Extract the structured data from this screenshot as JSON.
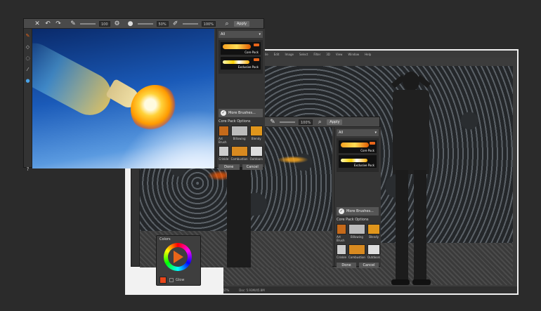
{
  "front_window": {
    "toolbar": {
      "field_1": "100",
      "field_2": "50%",
      "field_3": "100%",
      "apply_label": "Apply"
    },
    "panel": {
      "dropdown_value": "All",
      "presets": [
        {
          "label": "Core Pack"
        },
        {
          "label": "Exclusive Pack"
        }
      ],
      "more_label": "More Brushes...",
      "options_title": "Core Pack Options",
      "brushes": [
        "Art Brush",
        "Billowing",
        "Blendy",
        "Crinkle",
        "Combustion",
        "Outdoors"
      ],
      "ok_label": "Done",
      "cancel_label": "Cancel"
    }
  },
  "middle_window": {
    "toolbar": {
      "field_1": "100%",
      "apply_label": "Apply"
    },
    "panel": {
      "dropdown_value": "All",
      "presets": [
        {
          "label": "Core Pack"
        },
        {
          "label": "Exclusive Pack"
        }
      ],
      "more_label": "More Brushes...",
      "options_title": "Core Pack Options",
      "brushes": [
        "Art Brush",
        "Billowing",
        "Blendy",
        "Crinkle",
        "Combustion",
        "Outdoors"
      ],
      "ok_label": "Done",
      "cancel_label": "Cancel"
    }
  },
  "back_window": {
    "menu": [
      "File",
      "Edit",
      "Image",
      "Select",
      "Filter",
      "3D",
      "View",
      "Window",
      "Help"
    ],
    "status_zoom": "66.67%",
    "status_doc": "Doc: 5.93M/45.8M"
  },
  "color_panel": {
    "title": "Colors",
    "swatch_color": "#e8461a",
    "glow_label": "Glow"
  },
  "colors": {
    "accent": "#e8651a",
    "bg": "#2b2b2b"
  }
}
